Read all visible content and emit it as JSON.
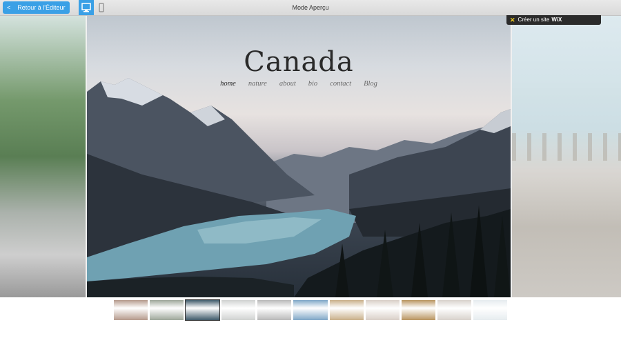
{
  "topbar": {
    "back_label": "Retour à l'Éditeur",
    "mode_title": "Mode Aperçu"
  },
  "wix_badge": {
    "text": "Créer un site",
    "brand": "WiX"
  },
  "site": {
    "title": "Canada",
    "nav": [
      {
        "label": "home",
        "active": true
      },
      {
        "label": "nature",
        "active": false
      },
      {
        "label": "about",
        "active": false
      },
      {
        "label": "bio",
        "active": false
      },
      {
        "label": "contact",
        "active": false
      },
      {
        "label": "Blog",
        "active": false
      }
    ]
  },
  "colors": {
    "accent": "#3aa0e6",
    "badge_bg": "#2b2b2b",
    "badge_x": "#f7d21e"
  },
  "thumbnails": [
    {
      "name": "city-sunset",
      "tone": "#b59a8c"
    },
    {
      "name": "street-trees",
      "tone": "#9ea79a"
    },
    {
      "name": "canada-lake",
      "tone": "#3f5a6a",
      "selected": true
    },
    {
      "name": "beach-pier",
      "tone": "#d0d2d1"
    },
    {
      "name": "grey-texture",
      "tone": "#b9b9b9"
    },
    {
      "name": "blue-house",
      "tone": "#7fa7c7"
    },
    {
      "name": "field-road",
      "tone": "#c9b08a"
    },
    {
      "name": "pale-room",
      "tone": "#d9cfc7"
    },
    {
      "name": "warm-interior",
      "tone": "#b99560"
    },
    {
      "name": "light-shelf",
      "tone": "#d8d2cc"
    },
    {
      "name": "white-door",
      "tone": "#e6ecef"
    }
  ]
}
